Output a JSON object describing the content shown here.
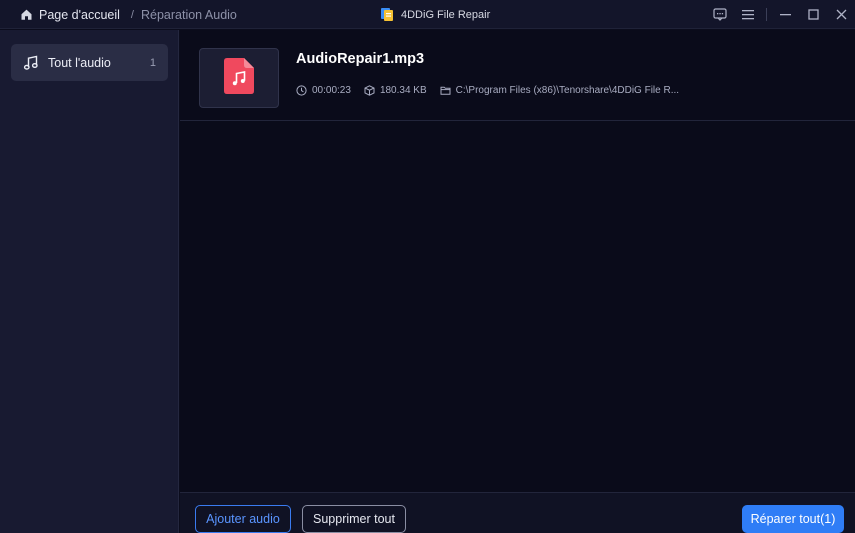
{
  "titlebar": {
    "breadcrumb_home": "Page d'accueil",
    "breadcrumb_separator": "/",
    "breadcrumb_current": "Réparation Audio",
    "app_title": "4DDiG File Repair",
    "controls": [
      "feedback-icon",
      "menu-icon",
      "minimize-icon",
      "maximize-icon",
      "close-icon"
    ]
  },
  "sidebar": {
    "items": [
      {
        "label": "Tout l'audio",
        "count": "1",
        "icon": "music-note-icon",
        "selected": true
      }
    ]
  },
  "files": [
    {
      "name": "AudioRepair1.mp3",
      "duration": "00:00:23",
      "size": "180.34 KB",
      "path": "C:\\Program Files (x86)\\Tenorshare\\4DDiG File R...",
      "icon": "audio-file-icon"
    }
  ],
  "footer": {
    "add_label": "Ajouter audio",
    "delete_all_label": "Supprimer tout",
    "repair_all_label": "Réparer tout(1)"
  },
  "colors": {
    "accent": "#2f7df6",
    "file_icon": "#f0495e",
    "background": "#0a0b1a",
    "sidebar": "#181a31"
  }
}
